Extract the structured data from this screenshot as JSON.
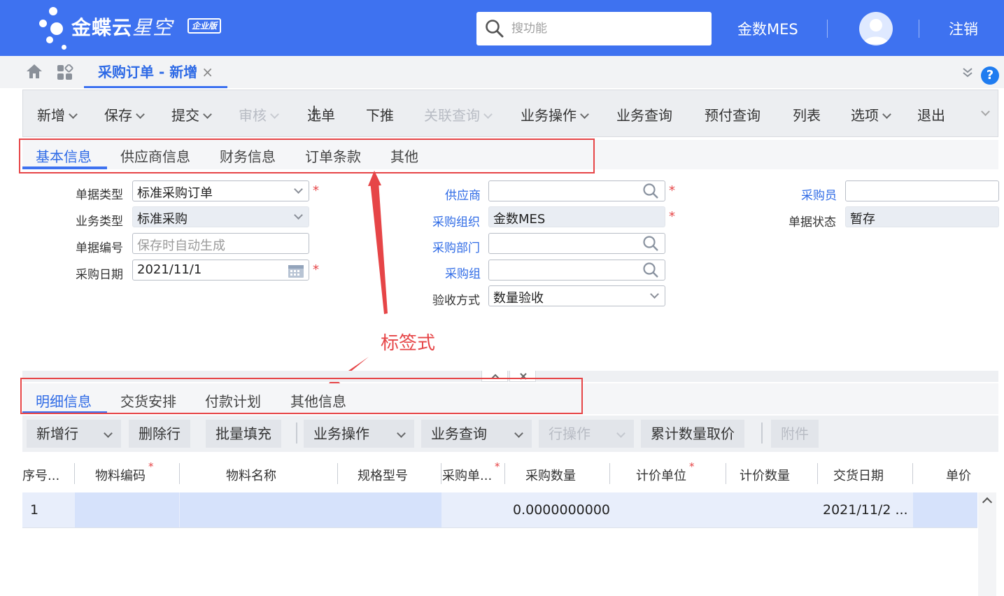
{
  "brand": {
    "name": "金蝶云",
    "product": "星空",
    "edition_badge": "企业版"
  },
  "search": {
    "placeholder": "搜功能"
  },
  "header": {
    "org": "金数MES",
    "logout": "注销"
  },
  "doc_tab": {
    "title": "采购订单 - 新增",
    "close": "×"
  },
  "toolbar": [
    {
      "label": "新增",
      "dropdown": true,
      "disabled": false
    },
    {
      "label": "保存",
      "dropdown": true,
      "disabled": false
    },
    {
      "label": "提交",
      "dropdown": true,
      "disabled": false
    },
    {
      "label": "审核",
      "dropdown": true,
      "disabled": true
    },
    {
      "label": "选单",
      "dropdown": false,
      "disabled": false
    },
    {
      "label": "下推",
      "dropdown": false,
      "disabled": false
    },
    {
      "label": "关联查询",
      "dropdown": true,
      "disabled": true
    },
    {
      "label": "业务操作",
      "dropdown": true,
      "disabled": false
    },
    {
      "label": "业务查询",
      "dropdown": false,
      "disabled": false
    },
    {
      "label": "预付查询",
      "dropdown": false,
      "disabled": false
    },
    {
      "label": "列表",
      "dropdown": false,
      "disabled": false
    },
    {
      "label": "选项",
      "dropdown": true,
      "disabled": false
    },
    {
      "label": "退出",
      "dropdown": false,
      "disabled": false
    }
  ],
  "section_tabs": [
    "基本信息",
    "供应商信息",
    "财务信息",
    "订单条款",
    "其他"
  ],
  "form": {
    "bill_type": {
      "label": "单据类型",
      "value": "标准采购订单",
      "required": true
    },
    "biz_type": {
      "label": "业务类型",
      "value": "标准采购"
    },
    "bill_no": {
      "label": "单据编号",
      "placeholder": "保存时自动生成"
    },
    "purchase_date": {
      "label": "采购日期",
      "value": "2021/11/1",
      "required": true
    },
    "supplier": {
      "label": "供应商",
      "value": "",
      "required": true
    },
    "purchase_org": {
      "label": "采购组织",
      "value": "金数MES",
      "required": true
    },
    "purchase_dept": {
      "label": "采购部门",
      "value": ""
    },
    "purchase_group": {
      "label": "采购组",
      "value": ""
    },
    "acceptance": {
      "label": "验收方式",
      "value": "数量验收"
    },
    "buyer": {
      "label": "采购员",
      "value": ""
    },
    "bill_status": {
      "label": "单据状态",
      "value": "暂存"
    }
  },
  "annotation": {
    "text": "标签式"
  },
  "detail_tabs": [
    "明细信息",
    "交货安排",
    "付款计划",
    "其他信息"
  ],
  "detail_toolbar": [
    {
      "label": "新增行",
      "dropdown": true,
      "disabled": false
    },
    {
      "label": "删除行",
      "dropdown": false,
      "disabled": false
    },
    {
      "label": "批量填充",
      "dropdown": false,
      "disabled": false
    },
    {
      "label": "业务操作",
      "dropdown": true,
      "disabled": false
    },
    {
      "label": "业务查询",
      "dropdown": true,
      "disabled": false
    },
    {
      "label": "行操作",
      "dropdown": true,
      "disabled": true
    },
    {
      "label": "累计数量取价",
      "dropdown": false,
      "disabled": false
    },
    {
      "label": "附件",
      "dropdown": false,
      "disabled": true
    }
  ],
  "grid": {
    "columns": [
      "序号...",
      "物料编码",
      "物料名称",
      "规格型号",
      "采购单...",
      "采购数量",
      "计价单位",
      "计价数量",
      "交货日期",
      "单价"
    ],
    "rows": [
      {
        "seq": "1",
        "qty": "0.0000000000",
        "delivery_date": "2021/11/2 ..."
      }
    ]
  },
  "colors": {
    "brand_blue": "#3e72f0",
    "link_blue": "#2f6be6",
    "annotation_red": "#e64547"
  }
}
